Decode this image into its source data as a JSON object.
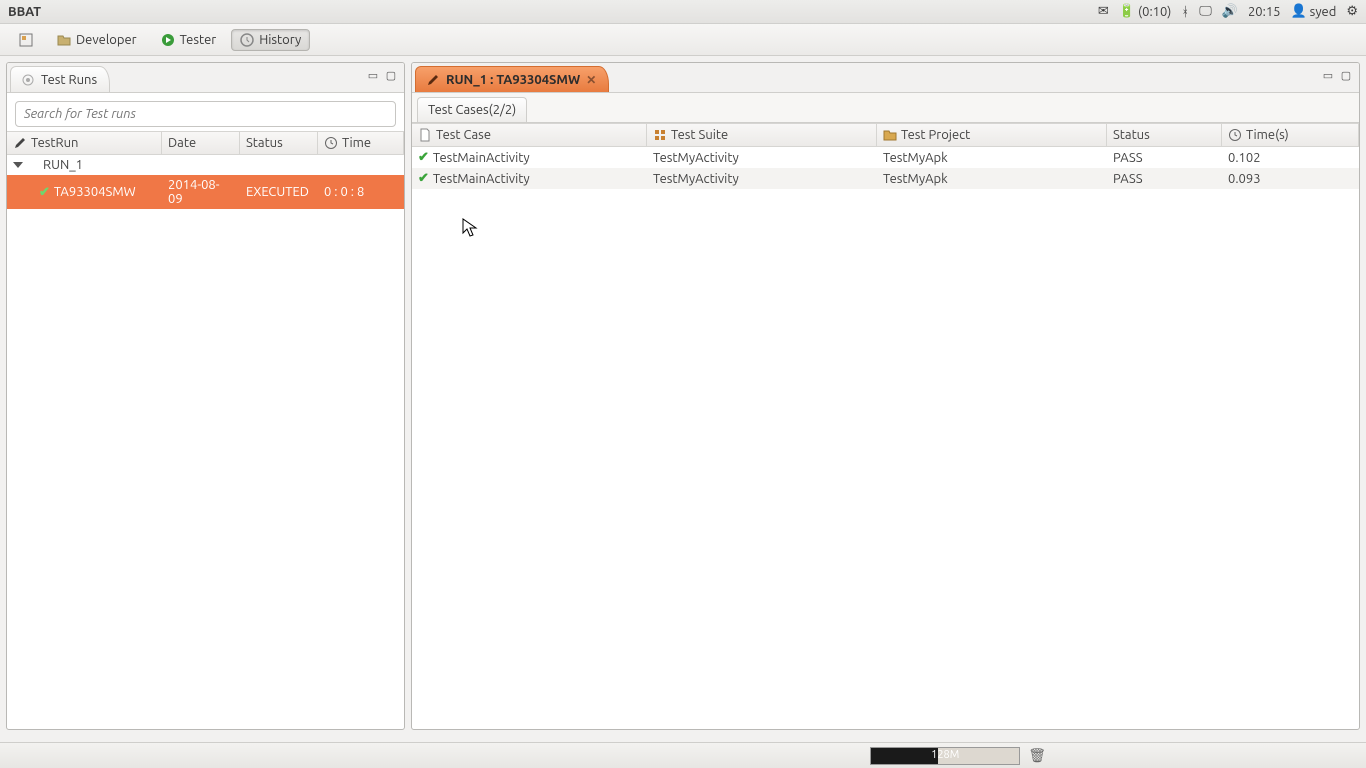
{
  "menubar": {
    "title": "BBAT",
    "battery": "(0:10)",
    "time": "20:15",
    "user": "syed"
  },
  "toolbar": {
    "developer": "Developer",
    "tester": "Tester",
    "history": "History"
  },
  "left": {
    "tab_title": "Test Runs",
    "search_placeholder": "Search for Test runs",
    "headers": {
      "run": "TestRun",
      "date": "Date",
      "status": "Status",
      "time": "Time"
    },
    "parent": "RUN_1",
    "row": {
      "name": "TA93304SMW",
      "date": "2014-08-09",
      "status": "EXECUTED",
      "time": "0 : 0 : 8"
    }
  },
  "right": {
    "tab_title": "RUN_1 : TA93304SMW",
    "sub_tab": "Test Cases(2/2)",
    "headers": {
      "case": "Test Case",
      "suite": "Test Suite",
      "proj": "Test Project",
      "status": "Status",
      "time": "Time(s)"
    },
    "rows": [
      {
        "case": "TestMainActivity",
        "suite": "TestMyActivity",
        "proj": "TestMyApk",
        "status": "PASS",
        "time": "0.102"
      },
      {
        "case": "TestMainActivity",
        "suite": "TestMyActivity",
        "proj": "TestMyApk",
        "status": "PASS",
        "time": "0.093"
      }
    ]
  },
  "status": {
    "mem": "128M"
  }
}
